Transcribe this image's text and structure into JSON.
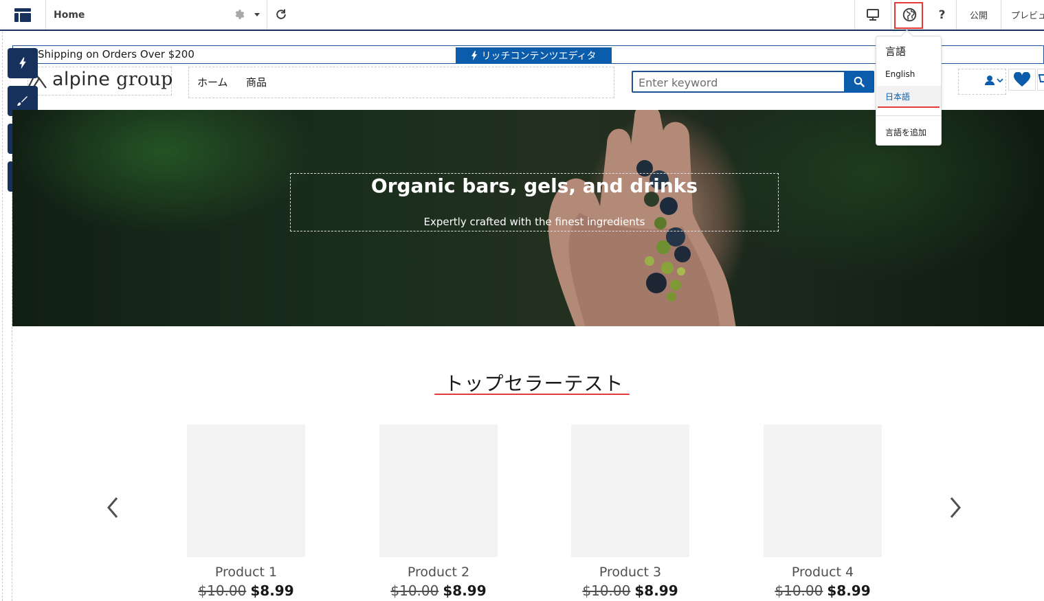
{
  "topbar": {
    "page_name": "Home",
    "publish_label": "公開",
    "preview_label": "プレビュ",
    "help_label": "?",
    "icons": [
      "app-menu-icon",
      "gear-icon",
      "refresh-icon",
      "desktop-icon",
      "globe-icon"
    ]
  },
  "language_menu": {
    "header": "言語",
    "items": [
      "English",
      "日本語"
    ],
    "selected": "日本語",
    "add_label": "言語を追加"
  },
  "store": {
    "announcement": "Shipping on Orders Over $200",
    "rich_content_badge": "リッチコンテンツエディタ",
    "logo": {
      "word1": "alpine",
      "word2": "group"
    },
    "nav": [
      "ホーム",
      "商品"
    ],
    "search_placeholder": "Enter keyword"
  },
  "hero": {
    "title": "Organic bars, gels, and drinks",
    "subtitle": "Expertly crafted with the finest ingredients"
  },
  "best_sellers": {
    "title": "トップセラーテスト",
    "products": [
      {
        "name": "Product 1",
        "old_price": "$10.00",
        "price": "$8.99"
      },
      {
        "name": "Product 2",
        "old_price": "$10.00",
        "price": "$8.99"
      },
      {
        "name": "Product 3",
        "old_price": "$10.00",
        "price": "$8.99"
      },
      {
        "name": "Product 4",
        "old_price": "$10.00",
        "price": "$8.99"
      }
    ]
  },
  "colors": {
    "brand_dark": "#16325c",
    "brand_blue": "#0b5cab",
    "highlight_red": "#e53935"
  }
}
